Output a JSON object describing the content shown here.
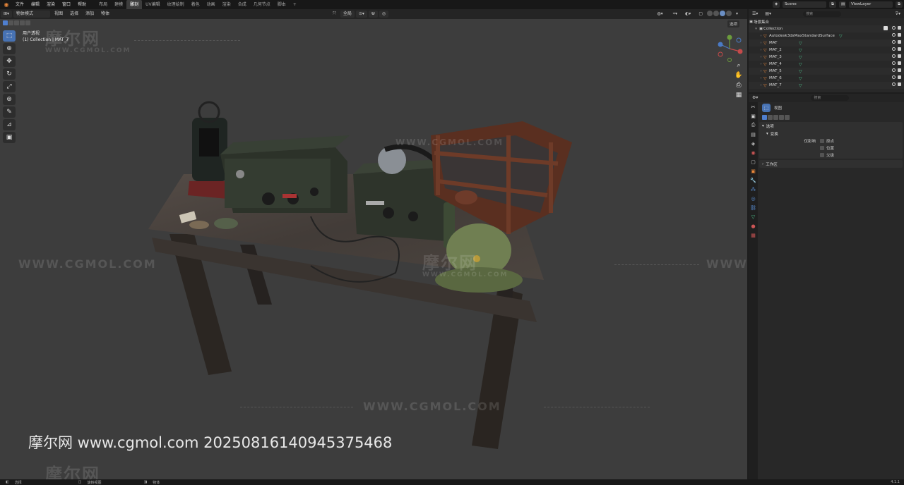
{
  "topbar": {
    "menus": [
      "文件",
      "编辑",
      "渲染",
      "窗口",
      "帮助"
    ],
    "workspaces": [
      "布局",
      "建模",
      "雕刻",
      "UV编辑",
      "纹理绘制",
      "着色",
      "动画",
      "渲染",
      "合成",
      "几何节点",
      "脚本"
    ],
    "active_workspace": "雕刻",
    "add_tab": "+",
    "scene": "Scene",
    "view_layer": "ViewLayer"
  },
  "viewport_header": {
    "mode": "物体模式",
    "menus": [
      "视图",
      "选择",
      "添加",
      "物体"
    ],
    "transform_orientation": "全局",
    "overlay_label": "选项"
  },
  "viewport": {
    "view_name": "用户透视",
    "collection_info": "(1) Collection | MAT_7"
  },
  "watermarks": {
    "cn": "摩尔网",
    "url": "WWW.CGMOL.COM",
    "bottom": "摩尔网 www.cgmol.com 20250816140945375468"
  },
  "outliner": {
    "search_placeholder": "搜索",
    "root": "场景集合",
    "collection": "Collection",
    "items": [
      {
        "name": "Autodesk3dsMaxStandardSurface"
      },
      {
        "name": "MAT"
      },
      {
        "name": "MAT_2"
      },
      {
        "name": "MAT_3"
      },
      {
        "name": "MAT_4"
      },
      {
        "name": "MAT_5"
      },
      {
        "name": "MAT_6"
      },
      {
        "name": "MAT_7"
      }
    ]
  },
  "properties": {
    "search_placeholder": "搜索",
    "title": "视图",
    "panels": {
      "selection": "选项",
      "transform": "变换",
      "affect_only": "仅影响",
      "origin": "原点",
      "location": "位置",
      "parent": "父级",
      "workspace": "工作区"
    }
  },
  "statusbar": {
    "select": "选择",
    "rotate_view": "旋转视图",
    "object": "物体",
    "version": "4.1.1"
  },
  "colors": {
    "accent": "#4772b3",
    "viewport_bg": "#3d3d3d",
    "object_orange": "#e8873a",
    "material_green": "#4cbf8a"
  }
}
